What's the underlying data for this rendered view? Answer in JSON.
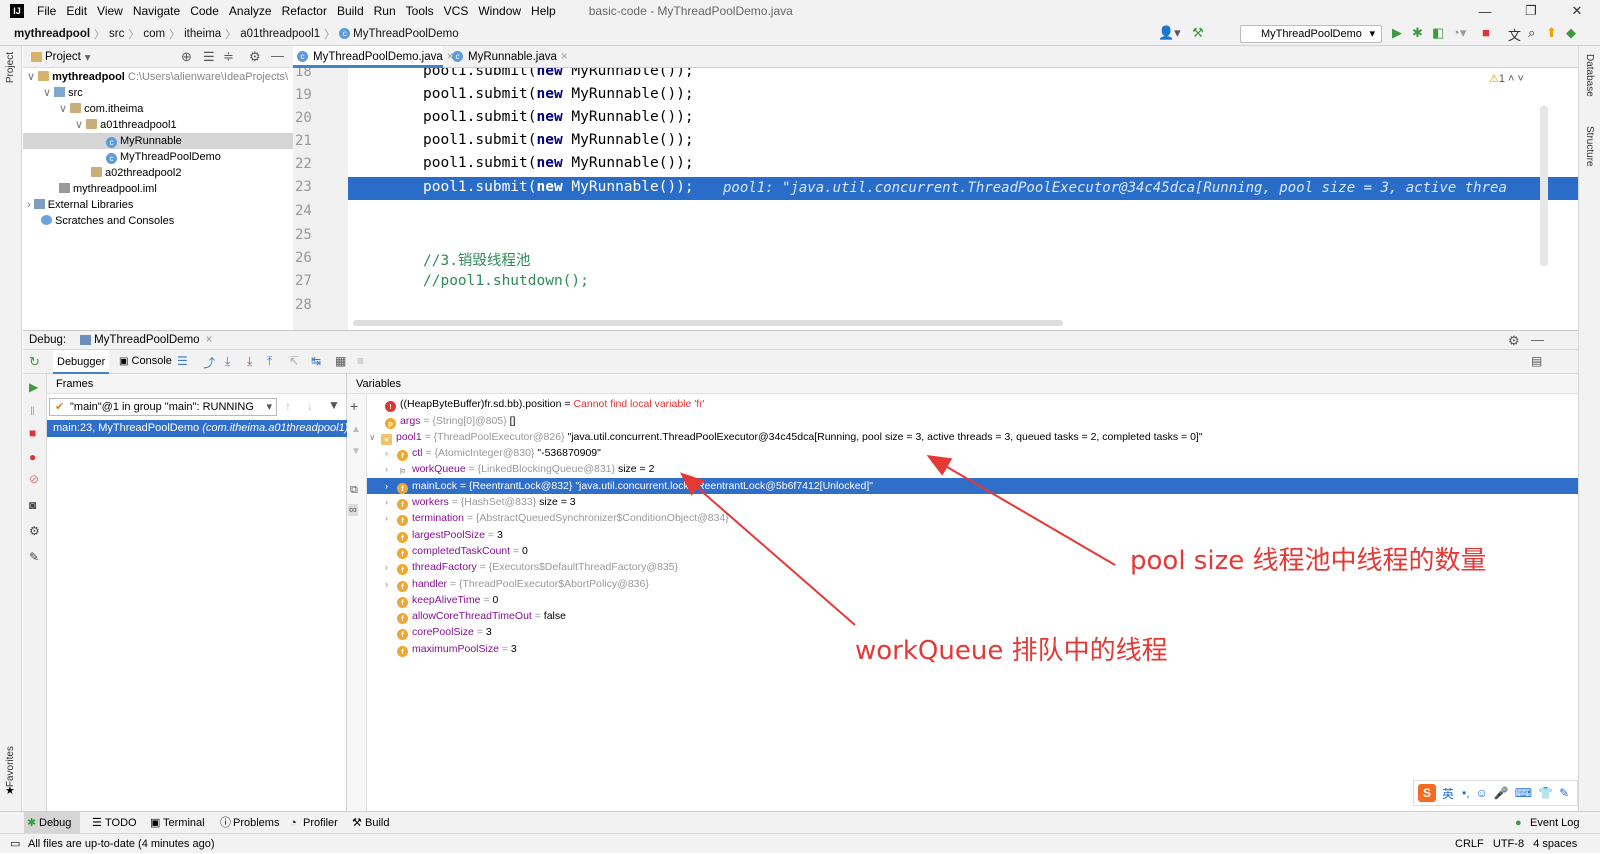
{
  "menu": {
    "items": [
      "File",
      "Edit",
      "View",
      "Navigate",
      "Code",
      "Analyze",
      "Refactor",
      "Build",
      "Run",
      "Tools",
      "VCS",
      "Window",
      "Help"
    ],
    "window_title": "basic-code - MyThreadPoolDemo.java"
  },
  "breadcrumb": [
    "mythreadpool",
    "src",
    "com",
    "itheima",
    "a01threadpool1",
    "MyThreadPoolDemo"
  ],
  "run_config": "MyThreadPoolDemo",
  "project": {
    "header": "Project",
    "root_name": "mythreadpool",
    "root_path": "C:\\Users\\alienware\\IdeaProjects\\",
    "src": "src",
    "pkg": "com.itheima",
    "pkg1": "a01threadpool1",
    "file1": "MyRunnable",
    "file2": "MyThreadPoolDemo",
    "pkg2": "a02threadpool2",
    "iml": "mythreadpool.iml",
    "ext": "External Libraries",
    "scratch": "Scratches and Consoles"
  },
  "side_labels": {
    "project": "Project",
    "favorites": "Favorites",
    "database": "Database",
    "structure": "Structure"
  },
  "editor_tabs": [
    "MyThreadPoolDemo.java",
    "MyRunnable.java"
  ],
  "editor": {
    "warnings": "1",
    "line_numbers": [
      "18",
      "19",
      "20",
      "21",
      "22",
      "23",
      "24",
      "25",
      "26",
      "27",
      "28"
    ],
    "code_submit_prefix": "pool1.submit(",
    "code_new": "new",
    "code_submit_suffix": " MyRunnable());",
    "inlay_hint": "pool1: \"java.util.concurrent.ThreadPoolExecutor@34c45dca[Running, pool size = 3, active threa",
    "comment1": "//3.销毁线程池",
    "comment2": "//pool1.shutdown();"
  },
  "debug": {
    "title": "Debug:",
    "config": "MyThreadPoolDemo",
    "tab_debugger": "Debugger",
    "tab_console": "Console",
    "frames_header": "Frames",
    "variables_header": "Variables",
    "thread": "\"main\"@1 in group \"main\": RUNNING",
    "frame": "main:23, MyThreadPoolDemo",
    "frame_pkg": "(com.itheima.a01threadpool1)"
  },
  "variables": {
    "err_expr": "((HeapByteBuffer)fr.sd.bb).position = ",
    "err_msg": "Cannot find local variable 'fr'",
    "args_name": "args",
    "args_type": " = {String[0]@805} ",
    "args_val": "[]",
    "pool_name": "pool1",
    "pool_type": " = {ThreadPoolExecutor@826} ",
    "pool_val": "\"java.util.concurrent.ThreadPoolExecutor@34c45dca[Running, pool size = 3, active threads = 3, queued tasks = 2, completed tasks = 0]\"",
    "rows": [
      {
        "name": "ctl",
        "type": " = {AtomicInteger@830} ",
        "val": "\"-536870909\""
      },
      {
        "name": "workQueue",
        "type": " = {LinkedBlockingQueue@831} ",
        "val": " size = 2"
      },
      {
        "name": "mainLock",
        "type": " = {ReentrantLock@832} ",
        "val": "\"java.util.concurrent.locks.ReentrantLock@5b6f7412[Unlocked]\""
      },
      {
        "name": "workers",
        "type": " = {HashSet@833} ",
        "val": " size = 3"
      },
      {
        "name": "termination",
        "type": " = {AbstractQueuedSynchronizer$ConditionObject@834}",
        "val": ""
      },
      {
        "name": "largestPoolSize",
        "type": " = ",
        "val": "3"
      },
      {
        "name": "completedTaskCount",
        "type": " = ",
        "val": "0"
      },
      {
        "name": "threadFactory",
        "type": " = {Executors$DefaultThreadFactory@835}",
        "val": ""
      },
      {
        "name": "handler",
        "type": " = {ThreadPoolExecutor$AbortPolicy@836}",
        "val": ""
      },
      {
        "name": "keepAliveTime",
        "type": " = ",
        "val": "0"
      },
      {
        "name": "allowCoreThreadTimeOut",
        "type": " = ",
        "val": "false"
      },
      {
        "name": "corePoolSize",
        "type": " = ",
        "val": "3"
      },
      {
        "name": "maximumPoolSize",
        "type": " = ",
        "val": "3"
      }
    ]
  },
  "annotations": {
    "pool_size": "pool size 线程池中线程的数量",
    "work_queue": "workQueue 排队中的线程",
    "color": "#e53935"
  },
  "bottom_tabs": [
    "Debug",
    "TODO",
    "Terminal",
    "Problems",
    "Profiler",
    "Build"
  ],
  "event_log": "Event Log",
  "status": {
    "message": "All files are up-to-date (4 minutes ago)",
    "right": "CRLF   UTF-8   4 spaces"
  },
  "ime": {
    "lang": "英"
  },
  "colors": {
    "selection": "#2f6fca",
    "editor_current_line": "#2a6dc8",
    "annotation": "#e53935"
  }
}
